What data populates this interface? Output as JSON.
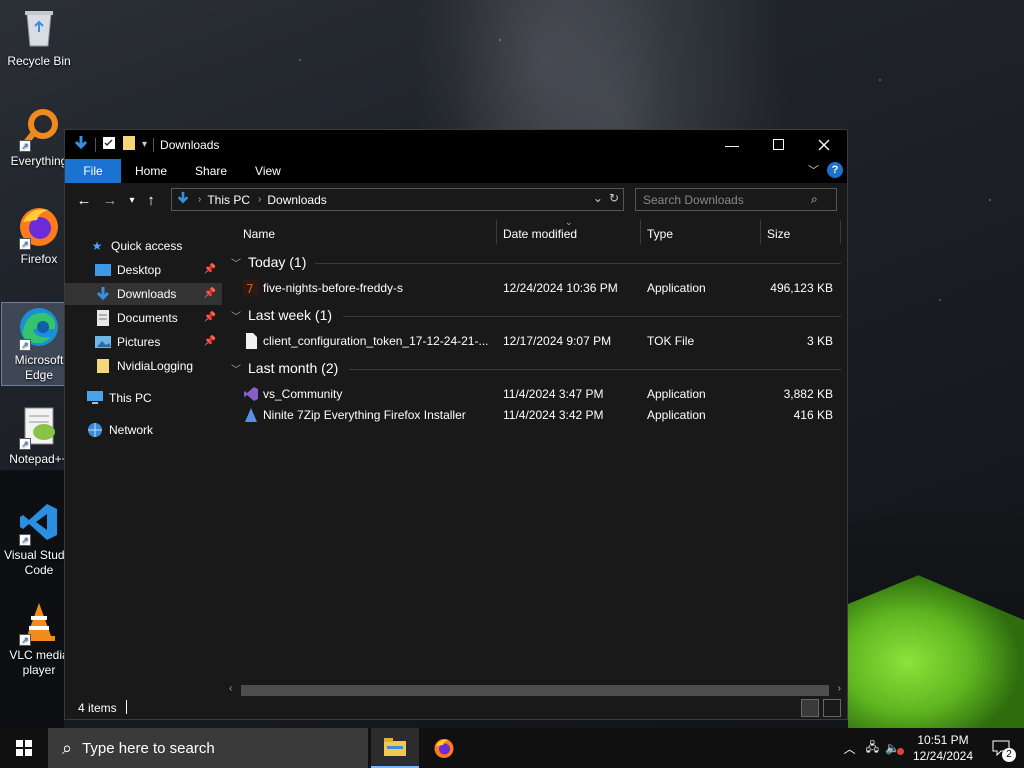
{
  "desktop": {
    "icons": [
      {
        "label": "Recycle Bin"
      },
      {
        "label": "Everything"
      },
      {
        "label": "Firefox"
      },
      {
        "label": "Microsoft Edge"
      },
      {
        "label": "Notepad++"
      },
      {
        "label": "Visual Studio Code"
      },
      {
        "label": "VLC media player"
      }
    ]
  },
  "window": {
    "title": "Downloads",
    "ribbon_tabs": [
      "File",
      "Home",
      "Share",
      "View"
    ],
    "address": {
      "segments": [
        "This PC",
        "Downloads"
      ]
    },
    "search": {
      "placeholder": "Search Downloads"
    },
    "nav": {
      "quick_access": "Quick access",
      "items": [
        "Desktop",
        "Downloads",
        "Documents",
        "Pictures",
        "NvidiaLogging"
      ],
      "this_pc": "This PC",
      "network": "Network"
    },
    "columns": [
      "Name",
      "Date modified",
      "Type",
      "Size"
    ],
    "groups": [
      {
        "label": "Today (1)",
        "files": [
          {
            "name": "five-nights-before-freddy-s",
            "date": "12/24/2024 10:36 PM",
            "type": "Application",
            "size": "496,123 KB"
          }
        ]
      },
      {
        "label": "Last week (1)",
        "files": [
          {
            "name": "client_configuration_token_17-12-24-21-...",
            "date": "12/17/2024 9:07 PM",
            "type": "TOK File",
            "size": "3 KB"
          }
        ]
      },
      {
        "label": "Last month (2)",
        "files": [
          {
            "name": "vs_Community",
            "date": "11/4/2024 3:47 PM",
            "type": "Application",
            "size": "3,882 KB"
          },
          {
            "name": "Ninite 7Zip Everything Firefox Installer",
            "date": "11/4/2024 3:42 PM",
            "type": "Application",
            "size": "416 KB"
          }
        ]
      }
    ],
    "status": {
      "item_count": "4 items"
    }
  },
  "taskbar": {
    "search_placeholder": "Type here to search",
    "time": "10:51 PM",
    "date": "12/24/2024",
    "notification_count": "2"
  },
  "colors": {
    "accent": "#1a73d1",
    "window_bg": "#191919",
    "titlebar_bg": "#000000",
    "taskbar_bg": "#101010"
  }
}
